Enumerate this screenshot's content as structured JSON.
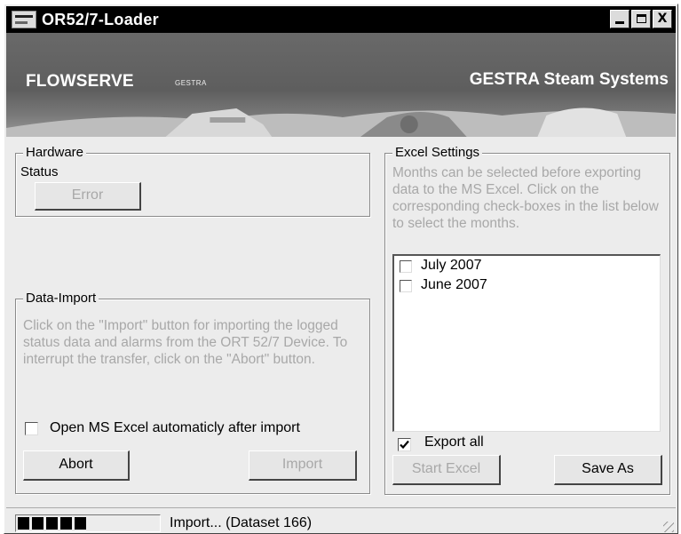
{
  "window": {
    "title": "OR52/7-Loader",
    "controls": {
      "minimize": "_",
      "maximize": "□",
      "close": "X"
    }
  },
  "banner": {
    "brand": "FLOWSERVE",
    "sub_brand": "GESTRA",
    "tagline": "GESTRA Steam Systems"
  },
  "hardware": {
    "legend": "Hardware",
    "status_label": "Status",
    "status_button": "Error"
  },
  "data_import": {
    "legend": "Data-Import",
    "description": "Click on the \"Import\" button for importing the logged status data and alarms from the ORT 52/7 Device. To interrupt the transfer, click on the \"Abort\" button.",
    "auto_excel_label": "Open MS Excel automaticly after import",
    "auto_excel_checked": false,
    "abort_button": "Abort",
    "import_button": "Import"
  },
  "excel_settings": {
    "legend": "Excel Settings",
    "description": "Months can be selected before exporting data to the MS Excel. Click on the corresponding check-boxes in the list below to select the months.",
    "months": [
      {
        "label": "July 2007",
        "checked": false
      },
      {
        "label": "June 2007",
        "checked": false
      }
    ],
    "export_all_label": "Export all",
    "export_all_checked": true,
    "start_excel_button": "Start Excel",
    "save_as_button": "Save As"
  },
  "status_bar": {
    "progress_segments": 5,
    "message": "Import... (Dataset 166)"
  },
  "icons": [
    "app-icon",
    "minimize-icon",
    "maximize-icon",
    "close-icon",
    "checkmark-icon",
    "resize-grip-icon"
  ]
}
